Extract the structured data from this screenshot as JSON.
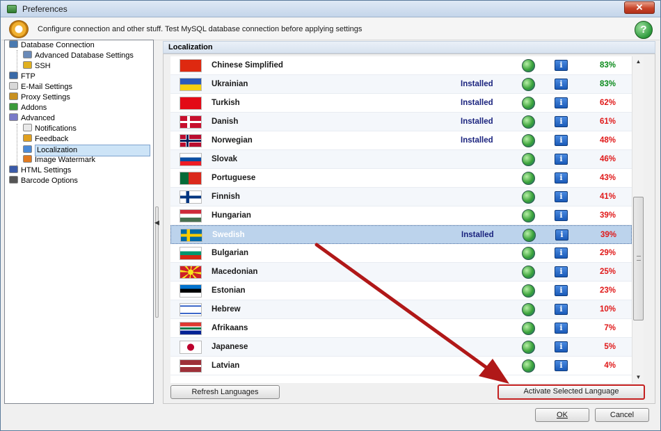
{
  "window": {
    "title": "Preferences",
    "close_label": "✕"
  },
  "header": {
    "text": "Configure connection and other stuff. Test MySQL database connection before applying settings",
    "help_label": "?"
  },
  "tree": {
    "items": [
      {
        "label": "Database Connection",
        "icon": "database-icon",
        "color": "#4a7ab0"
      },
      {
        "label": "Advanced Database Settings",
        "icon": "database-settings-icon",
        "color": "#6a8ab8"
      },
      {
        "label": "SSH",
        "icon": "lock-icon",
        "color": "#e0b020"
      },
      {
        "label": "FTP",
        "icon": "network-icon",
        "color": "#3a6aa8"
      },
      {
        "label": "E-Mail Settings",
        "icon": "envelope-icon",
        "color": "#d8d8d8"
      },
      {
        "label": "Proxy Settings",
        "icon": "key-icon",
        "color": "#c89020"
      },
      {
        "label": "Addons",
        "icon": "puzzle-icon",
        "color": "#3a9a3a"
      },
      {
        "label": "Advanced",
        "icon": "shield-icon",
        "color": "#7a7ac8"
      },
      {
        "label": "Notifications",
        "icon": "notification-icon",
        "color": "#e8e8e8"
      },
      {
        "label": "Feedback",
        "icon": "feedback-icon",
        "color": "#e0a020"
      },
      {
        "label": "Localization",
        "icon": "localization-icon",
        "color": "#4a8ad8"
      },
      {
        "label": "Image Watermark",
        "icon": "image-icon",
        "color": "#e07a20"
      },
      {
        "label": "HTML Settings",
        "icon": "html-icon",
        "color": "#3a5aa8"
      },
      {
        "label": "Barcode Options",
        "icon": "barcode-icon",
        "color": "#555555"
      }
    ]
  },
  "section": {
    "title": "Localization"
  },
  "languages": [
    {
      "name": "Chinese Simplified",
      "status": "",
      "percent": "83%",
      "pct_color": "green",
      "flag": "cn"
    },
    {
      "name": "Ukrainian",
      "status": "Installed",
      "percent": "83%",
      "pct_color": "green",
      "flag": "ua"
    },
    {
      "name": "Turkish",
      "status": "Installed",
      "percent": "62%",
      "pct_color": "",
      "flag": "tr"
    },
    {
      "name": "Danish",
      "status": "Installed",
      "percent": "61%",
      "pct_color": "",
      "flag": "dk"
    },
    {
      "name": "Norwegian",
      "status": "Installed",
      "percent": "48%",
      "pct_color": "red",
      "flag": "no"
    },
    {
      "name": "Slovak",
      "status": "",
      "percent": "46%",
      "pct_color": "red",
      "flag": "sk"
    },
    {
      "name": "Portuguese",
      "status": "",
      "percent": "43%",
      "pct_color": "red",
      "flag": "pt"
    },
    {
      "name": "Finnish",
      "status": "",
      "percent": "41%",
      "pct_color": "red",
      "flag": "fi"
    },
    {
      "name": "Hungarian",
      "status": "",
      "percent": "39%",
      "pct_color": "red",
      "flag": "hu"
    },
    {
      "name": "Swedish",
      "status": "Installed",
      "percent": "39%",
      "pct_color": "red",
      "flag": "se",
      "selected": true
    },
    {
      "name": "Bulgarian",
      "status": "",
      "percent": "29%",
      "pct_color": "red",
      "flag": "bg"
    },
    {
      "name": "Macedonian",
      "status": "",
      "percent": "25%",
      "pct_color": "red",
      "flag": "mk"
    },
    {
      "name": "Estonian",
      "status": "",
      "percent": "23%",
      "pct_color": "red",
      "flag": "ee"
    },
    {
      "name": "Hebrew",
      "status": "",
      "percent": "10%",
      "pct_color": "red",
      "flag": "il"
    },
    {
      "name": "Afrikaans",
      "status": "",
      "percent": "7%",
      "pct_color": "red",
      "flag": "za"
    },
    {
      "name": "Japanese",
      "status": "",
      "percent": "5%",
      "pct_color": "red",
      "flag": "jp"
    },
    {
      "name": "Latvian",
      "status": "",
      "percent": "4%",
      "pct_color": "red",
      "flag": "lv"
    }
  ],
  "buttons": {
    "refresh": "Refresh Languages",
    "activate": "Activate Selected Language",
    "ok": "OK",
    "cancel": "Cancel"
  },
  "colors": {
    "installed_text": "#1a237e",
    "percent_green": "#0a8a1a",
    "percent_red": "#e01818",
    "selection_bg": "#bcd3ec",
    "annotation_arrow": "#b01818"
  }
}
